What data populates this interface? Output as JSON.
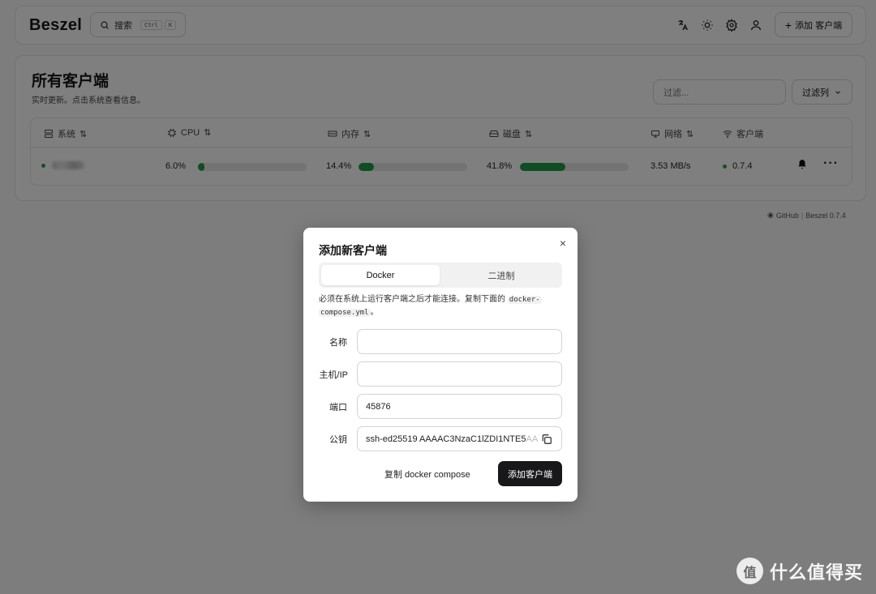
{
  "header": {
    "logo": "Beszel",
    "search_label": "搜索",
    "kbd_ctrl": "Ctrl",
    "kbd_k": "K",
    "add_client_label": "添加 客户端"
  },
  "main": {
    "title": "所有客户端",
    "subtitle": "实时更新。点击系统查看信息。",
    "filter_placeholder": "过滤...",
    "filter_columns_label": "过滤列"
  },
  "table": {
    "columns": [
      "系统",
      "CPU",
      "内存",
      "磁盘",
      "网络",
      "客户端"
    ],
    "rows": [
      {
        "cpu": "6.0%",
        "cpu_fraction": 0.06,
        "memory": "14.4%",
        "memory_fraction": 0.144,
        "disk": "41.8%",
        "disk_fraction": 0.418,
        "network": "3.53 MB/s",
        "agent_version": "0.7.4"
      }
    ]
  },
  "footer": {
    "github": "GitHub",
    "separator": "|",
    "version": "Beszel 0.7.4"
  },
  "dialog": {
    "title": "添加新客户端",
    "close": "×",
    "tabs": [
      "Docker",
      "二进制"
    ],
    "description_prefix": "必须在系统上运行客户端之后才能连接。复制下面的 ",
    "description_code_1": "docker-",
    "description_code_2": "compose.yml",
    "description_suffix": "。",
    "fields": {
      "name_label": "名称",
      "name_value": "",
      "host_label": "主机/IP",
      "host_value": "",
      "port_label": "端口",
      "port_value": "45876",
      "key_label": "公钥",
      "key_value": "ssh-ed25519 AAAAC3NzaC1lZDI1NTE5",
      "key_overflow": "AA"
    },
    "copy_compose_label": "复制 docker compose",
    "submit_label": "添加客户端"
  },
  "watermark": {
    "glyph": "值",
    "text": "什么值得买"
  },
  "colors": {
    "accent_green": "#1e9b45",
    "primary_button": "#18181b"
  }
}
